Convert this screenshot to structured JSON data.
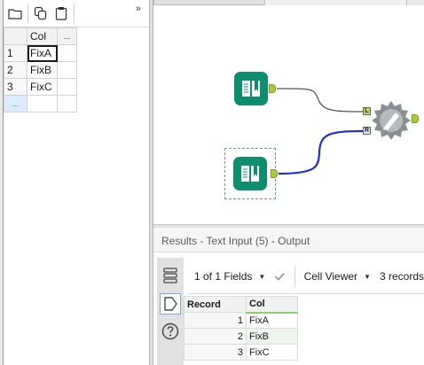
{
  "input_panel": {
    "grid": {
      "header": [
        "",
        "Col",
        "..."
      ],
      "rows": [
        {
          "num": "1",
          "value": "FixA"
        },
        {
          "num": "2",
          "value": "FixB"
        },
        {
          "num": "3",
          "value": "FixC"
        }
      ],
      "new_row_marker": "..."
    },
    "collapse_glyph": "»",
    "toolbar_icons": [
      "folder-icon",
      "copy-icon",
      "clipboard-icon"
    ]
  },
  "canvas": {
    "tools": [
      {
        "name": "text-input-tool-1",
        "icon": "book-icon"
      },
      {
        "name": "text-input-tool-2",
        "icon": "book-icon"
      },
      {
        "name": "formula-tool",
        "icon": "formula-icon"
      }
    ],
    "join_inputs": {
      "left": "L",
      "right": "R"
    },
    "colors": {
      "tool_green": "#0d8f6f",
      "anchor_green": "#a6ce39",
      "wire_selected": "#1f2fd0",
      "wire_default": "#555555"
    }
  },
  "results": {
    "title": "Results - Text Input (5) - Output",
    "fields_selector": "1 of 1 Fields",
    "viewer": "Cell Viewer",
    "record_count": "3 records",
    "columns": [
      "Record",
      "Col"
    ],
    "rows": [
      {
        "record": "1",
        "col": "FixA"
      },
      {
        "record": "2",
        "col": "FixB"
      },
      {
        "record": "3",
        "col": "FixC"
      }
    ]
  }
}
